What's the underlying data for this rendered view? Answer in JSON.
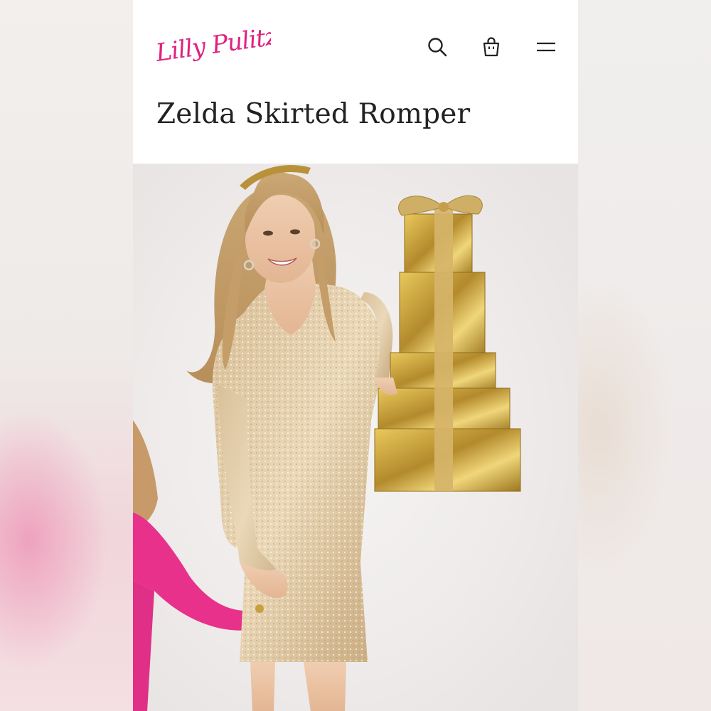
{
  "brand": {
    "logo_text": "Lilly Pulitzer",
    "color": "#e0217f"
  },
  "header": {
    "icons": [
      "search-icon",
      "shopping-bag-icon",
      "menu-icon"
    ]
  },
  "product": {
    "title": "Zelda Skirted Romper"
  },
  "image": {
    "alt": "Model in gold sequin skirted romper holding stacked gold gift boxes"
  },
  "colors": {
    "accent": "#e0217f",
    "gold": "#c9a55a",
    "pink_sweater": "#e8318a"
  }
}
